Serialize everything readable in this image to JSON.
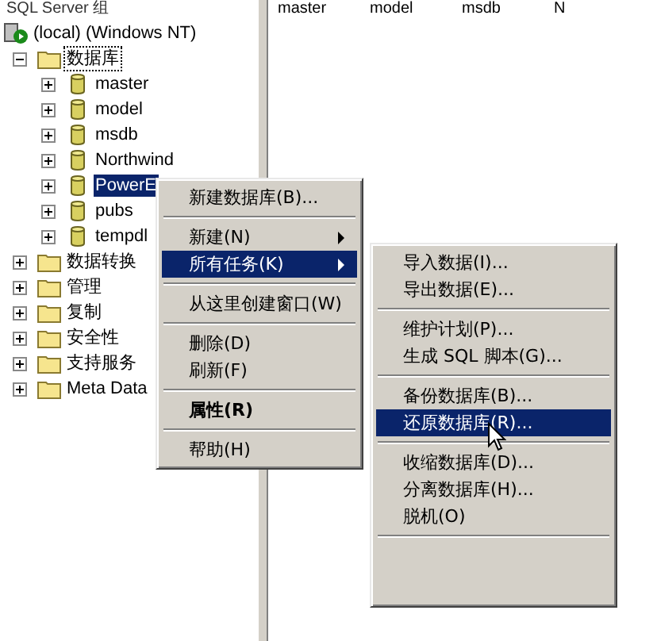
{
  "tree_header": "SQL Server 组",
  "list_columns": [
    "master",
    "model",
    "msdb",
    "N"
  ],
  "tree": [
    {
      "label": "(local) (Windows NT)",
      "kind": "server",
      "expanded": true,
      "selected": false,
      "children": [
        {
          "label": "数据库",
          "kind": "folder",
          "expanded": true,
          "selected": false,
          "focused": true,
          "children": [
            {
              "label": "master",
              "kind": "database",
              "expanded": false,
              "selected": false
            },
            {
              "label": "model",
              "kind": "database",
              "expanded": false,
              "selected": false
            },
            {
              "label": "msdb",
              "kind": "database",
              "expanded": false,
              "selected": false
            },
            {
              "label": "Northwind",
              "kind": "database",
              "expanded": false,
              "selected": false
            },
            {
              "label": "PowerE",
              "kind": "database",
              "expanded": false,
              "selected": true
            },
            {
              "label": "pubs",
              "kind": "database",
              "expanded": false,
              "selected": false
            },
            {
              "label": "tempdl",
              "kind": "database",
              "expanded": false,
              "selected": false
            }
          ]
        },
        {
          "label": "数据转换",
          "kind": "folder",
          "expanded": false,
          "selected": false
        },
        {
          "label": "管理",
          "kind": "folder",
          "expanded": false,
          "selected": false
        },
        {
          "label": "复制",
          "kind": "folder",
          "expanded": false,
          "selected": false
        },
        {
          "label": "安全性",
          "kind": "folder",
          "expanded": false,
          "selected": false
        },
        {
          "label": "支持服务",
          "kind": "folder",
          "expanded": false,
          "selected": false
        },
        {
          "label": "Meta Data",
          "kind": "folder",
          "expanded": false,
          "selected": false
        }
      ]
    }
  ],
  "context_menu": [
    {
      "kind": "item",
      "label": "新建数据库(B)...",
      "selected": false,
      "submenu": false,
      "bold": false
    },
    {
      "kind": "separator"
    },
    {
      "kind": "item",
      "label": "新建(N)",
      "selected": false,
      "submenu": true,
      "bold": false
    },
    {
      "kind": "item",
      "label": "所有任务(K)",
      "selected": true,
      "submenu": true,
      "bold": false
    },
    {
      "kind": "separator"
    },
    {
      "kind": "item",
      "label": "从这里创建窗口(W)",
      "selected": false,
      "submenu": false,
      "bold": false
    },
    {
      "kind": "separator"
    },
    {
      "kind": "item",
      "label": "删除(D)",
      "selected": false,
      "submenu": false,
      "bold": false
    },
    {
      "kind": "item",
      "label": "刷新(F)",
      "selected": false,
      "submenu": false,
      "bold": false
    },
    {
      "kind": "separator"
    },
    {
      "kind": "item",
      "label": "属性(R)",
      "selected": false,
      "submenu": false,
      "bold": true
    },
    {
      "kind": "separator"
    },
    {
      "kind": "item",
      "label": "帮助(H)",
      "selected": false,
      "submenu": false,
      "bold": false
    }
  ],
  "submenu": [
    {
      "kind": "item",
      "label": "导入数据(I)...",
      "selected": false
    },
    {
      "kind": "item",
      "label": "导出数据(E)...",
      "selected": false
    },
    {
      "kind": "separator"
    },
    {
      "kind": "item",
      "label": "维护计划(P)...",
      "selected": false
    },
    {
      "kind": "item",
      "label": "生成 SQL 脚本(G)...",
      "selected": false
    },
    {
      "kind": "separator"
    },
    {
      "kind": "item",
      "label": "备份数据库(B)...",
      "selected": false
    },
    {
      "kind": "item",
      "label": "还原数据库(R)...",
      "selected": true
    },
    {
      "kind": "separator"
    },
    {
      "kind": "item",
      "label": "收缩数据库(D)...",
      "selected": false
    },
    {
      "kind": "item",
      "label": "分离数据库(H)...",
      "selected": false
    },
    {
      "kind": "item",
      "label": "脱机(O)",
      "selected": false
    },
    {
      "kind": "separator"
    }
  ]
}
